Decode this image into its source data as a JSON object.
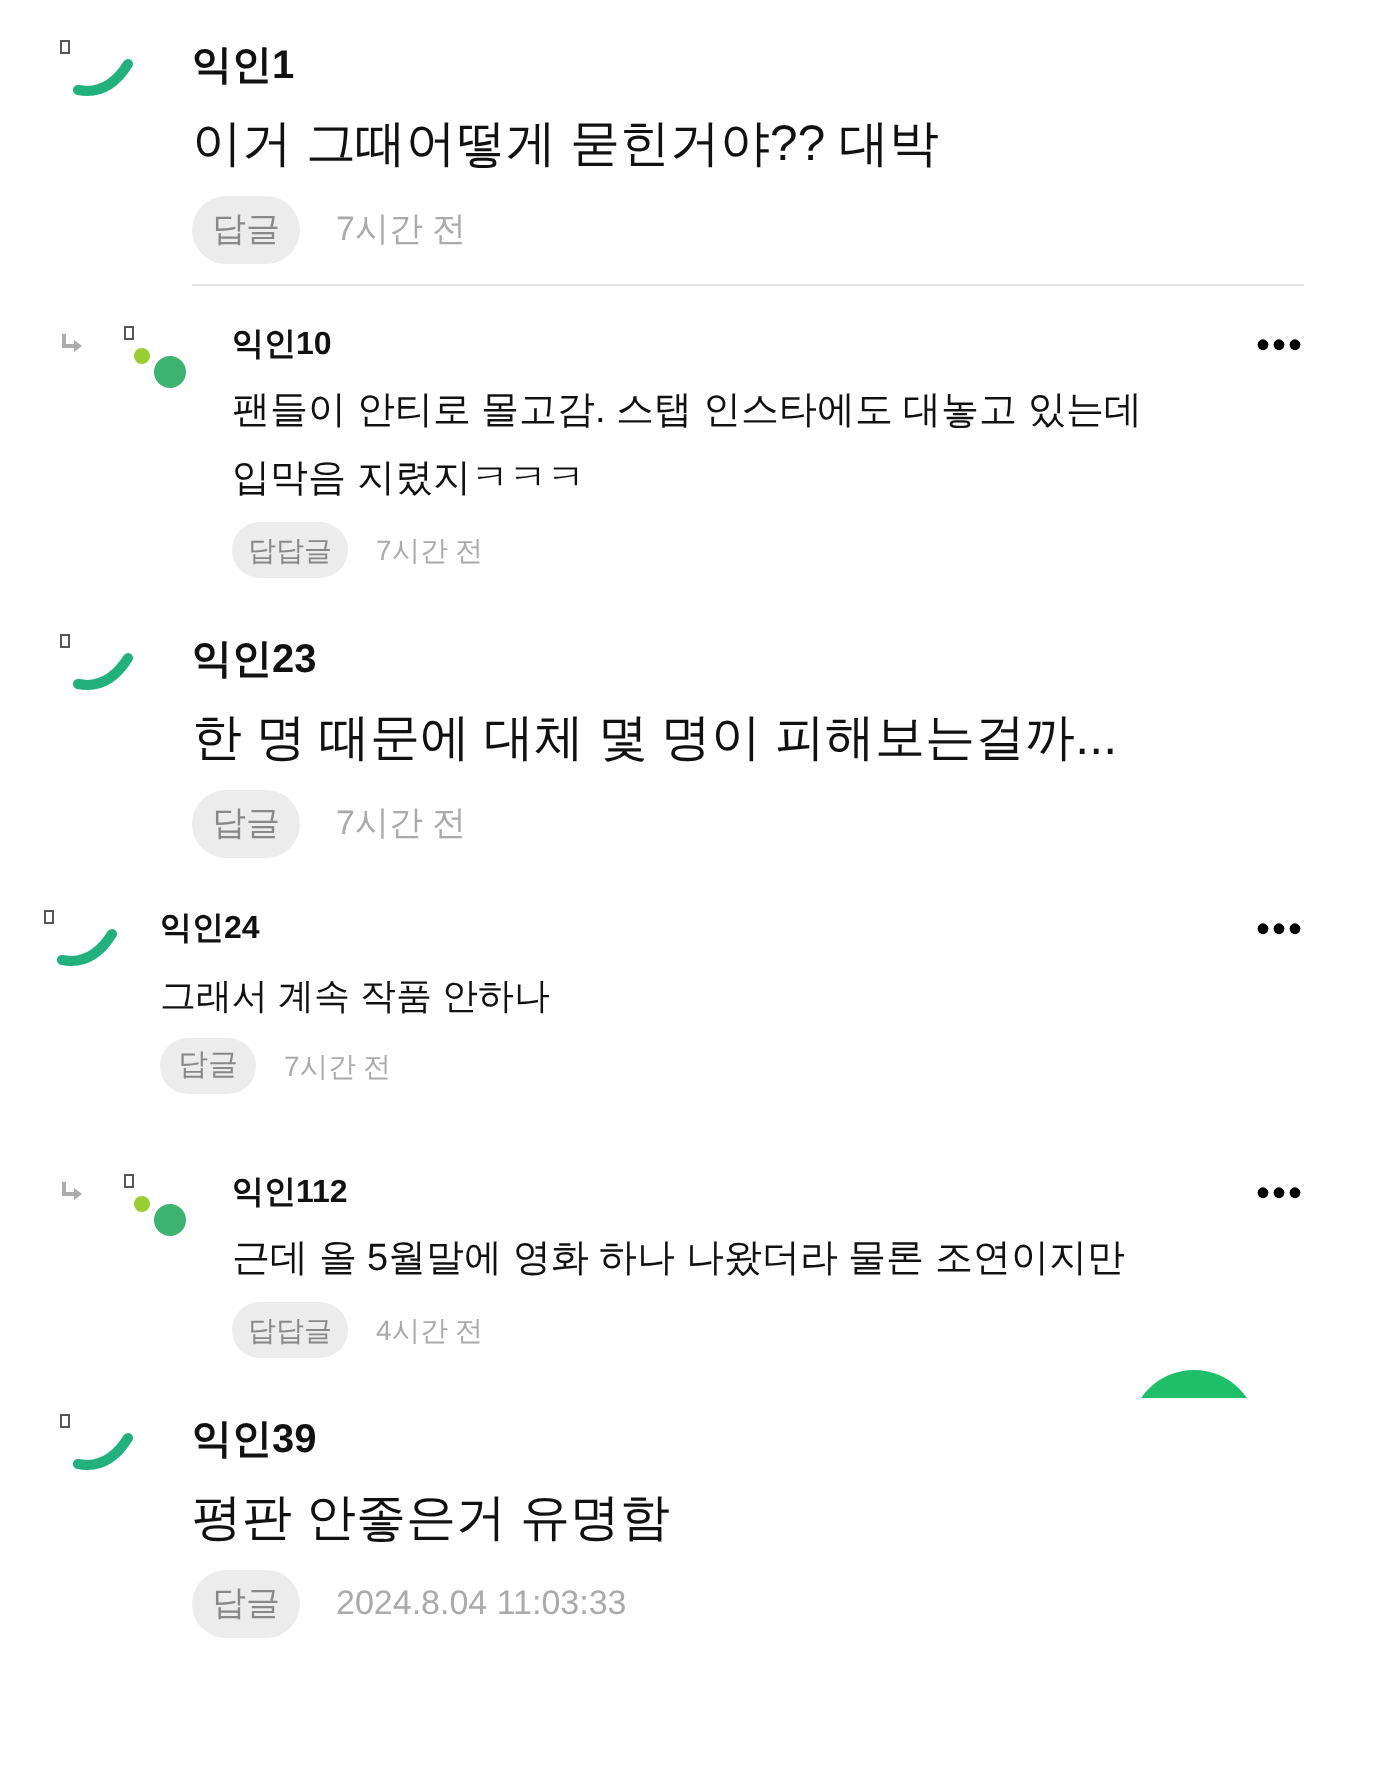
{
  "comments": [
    {
      "kind": "comment",
      "author": "익인1",
      "body": [
        "이거 그때어떻게 묻힌거야?? 대박"
      ],
      "reply_button": "답글",
      "time": "7시간 전",
      "divider": true
    },
    {
      "kind": "reply",
      "author": "익인10",
      "menu": "•••",
      "body": [
        "팬들이 안티로 몰고감. 스탭 인스타에도 대놓고 있는데",
        "입막음 지렸지ㅋㅋㅋ"
      ],
      "reply_button": "답답글",
      "time": "7시간 전"
    },
    {
      "kind": "comment",
      "author": "익인23",
      "body": [
        "한 명 때문에 대체 몇 명이 피해보는걸까..."
      ],
      "reply_button": "답글",
      "time": "7시간 전"
    },
    {
      "kind": "compact",
      "author": "익인24",
      "menu": "•••",
      "body": [
        "그래서 계속 작품 안하나"
      ],
      "reply_button": "답글",
      "time": "7시간 전"
    },
    {
      "kind": "reply",
      "author": "익인112",
      "menu": "•••",
      "body": [
        "근데 올 5월말에 영화 하나 나왔더라 물론 조연이지만"
      ],
      "reply_button": "답답글",
      "time": "4시간 전",
      "floating_button": true
    },
    {
      "kind": "comment",
      "author": "익인39",
      "body": [
        "평판 안좋은거 유명함"
      ],
      "reply_button": "답글",
      "time": "2024.8.04 11:03:33"
    }
  ]
}
